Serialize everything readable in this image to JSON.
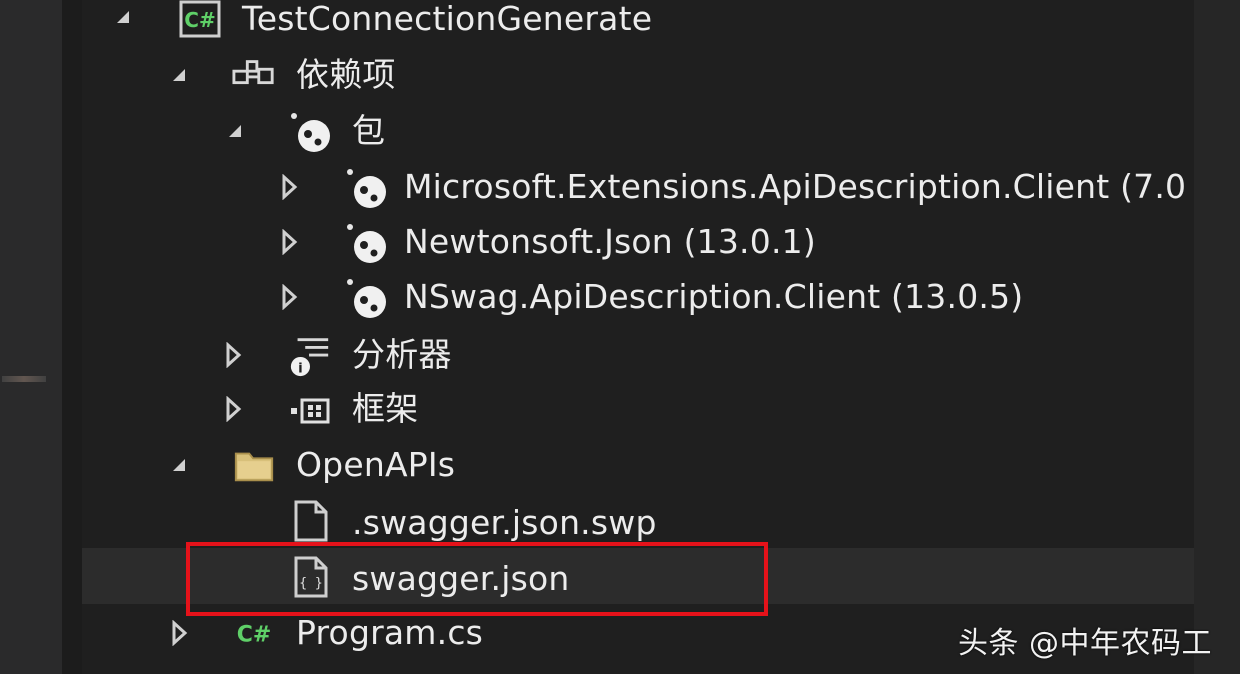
{
  "tree": {
    "project": {
      "label": "TestConnectionGenerate",
      "icon": "csharp-project-icon",
      "badge": "C#"
    },
    "dependencies": {
      "label": "依赖项",
      "icon": "dependencies-icon"
    },
    "packages": {
      "label": "包",
      "icon": "package-icon"
    },
    "package_items": [
      {
        "label": "Microsoft.Extensions.ApiDescription.Client (7.0",
        "icon": "package-icon"
      },
      {
        "label": "Newtonsoft.Json (13.0.1)",
        "icon": "package-icon"
      },
      {
        "label": "NSwag.ApiDescription.Client (13.0.5)",
        "icon": "package-icon"
      }
    ],
    "analyzers": {
      "label": "分析器",
      "icon": "analyzer-icon"
    },
    "frameworks": {
      "label": "框架",
      "icon": "framework-icon"
    },
    "openapis_folder": {
      "label": "OpenAPIs",
      "icon": "folder-icon"
    },
    "swp_file": {
      "label": ".swagger.json.swp",
      "icon": "file-icon"
    },
    "swagger_file": {
      "label": "swagger.json",
      "icon": "json-file-icon",
      "json_glyph": "{ }"
    },
    "program_file": {
      "label": "Program.cs",
      "icon": "csharp-file-icon",
      "badge": "C#"
    }
  },
  "watermark": {
    "text": "头条 @中年农码工"
  },
  "colors": {
    "background": "#1f1f1f",
    "text": "#ececec",
    "highlight_border": "#e5121a",
    "csharp_green": "#5fd068",
    "folder_yellow": "#d8c07a",
    "selected_row": "#2c2c2c"
  }
}
